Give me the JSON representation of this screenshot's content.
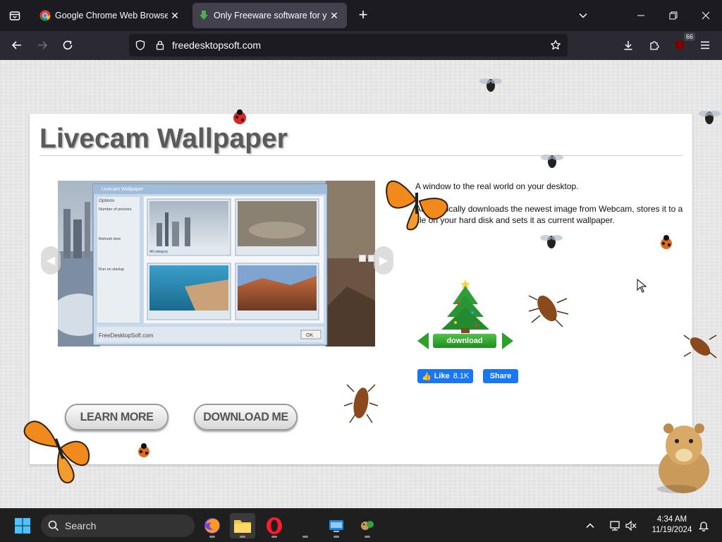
{
  "browser": {
    "tabs": [
      {
        "title": "Google Chrome Web Browser",
        "active": false
      },
      {
        "title": "Only Freeware software for you",
        "active": true
      }
    ],
    "url": "freedesktopsoft.com",
    "extension_badge": "66"
  },
  "page": {
    "title": "Livecam Wallpaper",
    "description": [
      "A window to the real world on your desktop.",
      "Automatically downloads the newest image from Webcam, stores it to a file on your hard disk and sets it as current wallpaper."
    ],
    "buttons": {
      "learn_more": "LEARN MORE",
      "download_me": "DOWNLOAD ME"
    },
    "download_label": "download",
    "facebook": {
      "like": "Like",
      "count": "8.1K",
      "share": "Share"
    },
    "app_window": {
      "title": "Livecam Wallpaper",
      "options_label": "Options",
      "number_of_pictures": "Number of pictures",
      "refresh_time": "Refresh time",
      "run_on_startup": "Run on startup",
      "ok": "OK",
      "footer": "FreeDesktopSoft.com",
      "category": "All category"
    }
  },
  "taskbar": {
    "search_placeholder": "Search",
    "time": "4:34 AM",
    "date": "11/19/2024"
  },
  "colors": {
    "browser_bg": "#1c1b22",
    "nav_bg": "#2b2a33",
    "active_tab": "#42414d",
    "download_green": "#2ea02a",
    "facebook_blue": "#1877f2"
  }
}
